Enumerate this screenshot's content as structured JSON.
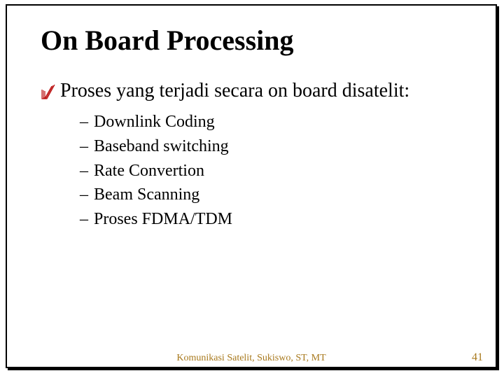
{
  "title": "On Board Processing",
  "lead": "Proses yang terjadi secara on board disatelit:",
  "items": [
    "Downlink Coding",
    "Baseband switching",
    "Rate Convertion",
    "Beam Scanning",
    "Proses FDMA/TDM"
  ],
  "footer": "Komunikasi Satelit, Sukiswo, ST, MT",
  "page": "41"
}
